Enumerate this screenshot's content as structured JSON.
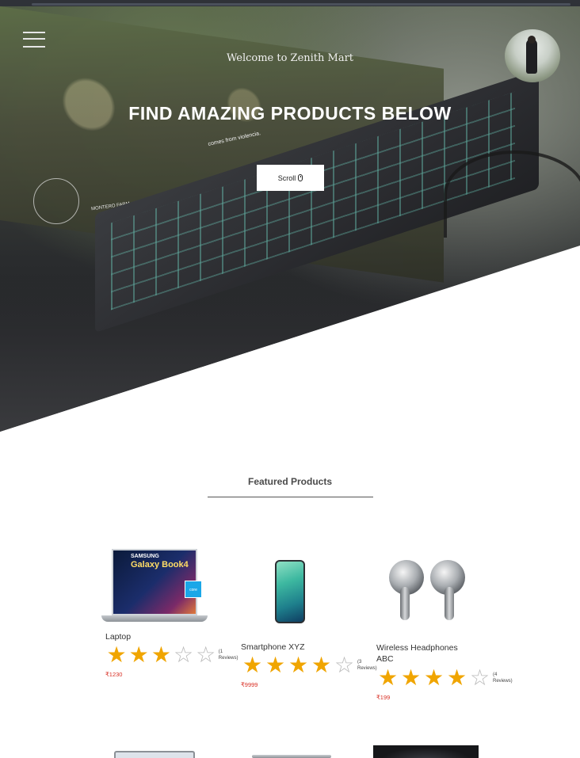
{
  "hero": {
    "welcome": "Welcome to Zenith Mart",
    "title": "FIND AMAZING PRODUCTS BELOW",
    "scroll_label": "Scroll",
    "graffiti": "comes from violencia.",
    "hud_label": "MONTERO FARM"
  },
  "featured": {
    "title": "Featured Products"
  },
  "products": [
    {
      "name": "Laptop",
      "rating": 3,
      "max_rating": 5,
      "reviews": "(1 Reviews)",
      "price": "₹1230",
      "image_text": {
        "brand": "SAMSUNG",
        "model": "Galaxy Book4",
        "badge": "core"
      }
    },
    {
      "name": "Smartphone XYZ",
      "rating": 4,
      "max_rating": 5,
      "reviews": "(3 Reviews)",
      "price": "₹9999"
    },
    {
      "name": "Wireless Headphones ABC",
      "rating": 4,
      "max_rating": 5,
      "reviews": "(4 Reviews)",
      "price": "₹199"
    }
  ],
  "icons": {
    "menu": "hamburger-menu-icon",
    "scroll": "mouse-icon",
    "star_full": "★",
    "star_empty": "☆"
  },
  "colors": {
    "star": "#f0a500",
    "price": "#d93025",
    "scroll_button_bg": "#ffffff"
  }
}
